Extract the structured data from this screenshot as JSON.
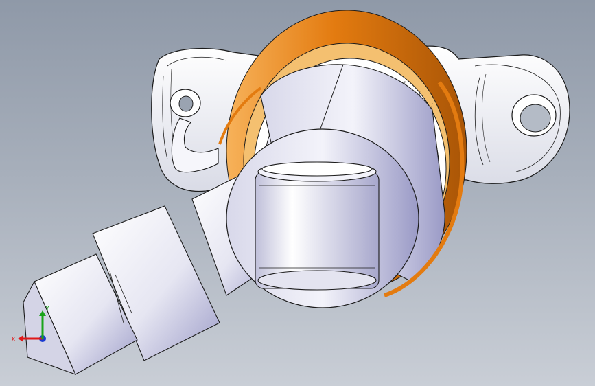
{
  "viewport": {
    "background_top": "#8f99a8",
    "background_bottom": "#c9ced6"
  },
  "model": {
    "part_color": "#f2f2f7",
    "shaded_color": "#9c9cc8",
    "edge_color": "#1b1b1b",
    "bearing_color": "#e37b10"
  },
  "triad": {
    "x_label": "X",
    "y_label": "Y",
    "x_color": "#e01818",
    "y_color": "#1aa31a",
    "z_color": "#1a3ad0"
  }
}
